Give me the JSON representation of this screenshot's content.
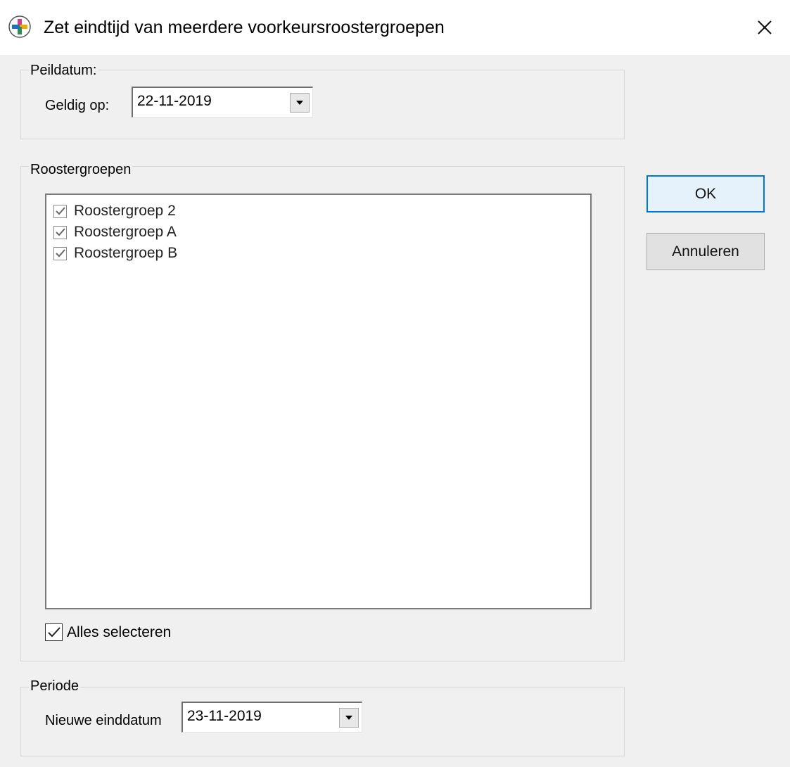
{
  "window": {
    "title": "Zet eindtijd van meerdere voorkeursroostergroepen",
    "close_icon": "close-icon",
    "app_icon": "colored-cross-icon"
  },
  "peildatum": {
    "group_label": "Peildatum:",
    "field_label": "Geldig op:",
    "value": "22-11-2019"
  },
  "roostergroepen": {
    "group_label": "Roostergroepen",
    "items": [
      {
        "label": "Roostergroep 2",
        "checked": true
      },
      {
        "label": "Roostergroep A",
        "checked": true
      },
      {
        "label": "Roostergroep B",
        "checked": true
      }
    ],
    "select_all_label": "Alles selecteren",
    "select_all_checked": true
  },
  "periode": {
    "group_label": "Periode",
    "field_label": "Nieuwe einddatum",
    "value": "23-11-2019"
  },
  "buttons": {
    "ok_label": "OK",
    "cancel_label": "Annuleren"
  },
  "colors": {
    "focus_border": "#0078d7",
    "dialog_bg": "#f0f0f0"
  }
}
